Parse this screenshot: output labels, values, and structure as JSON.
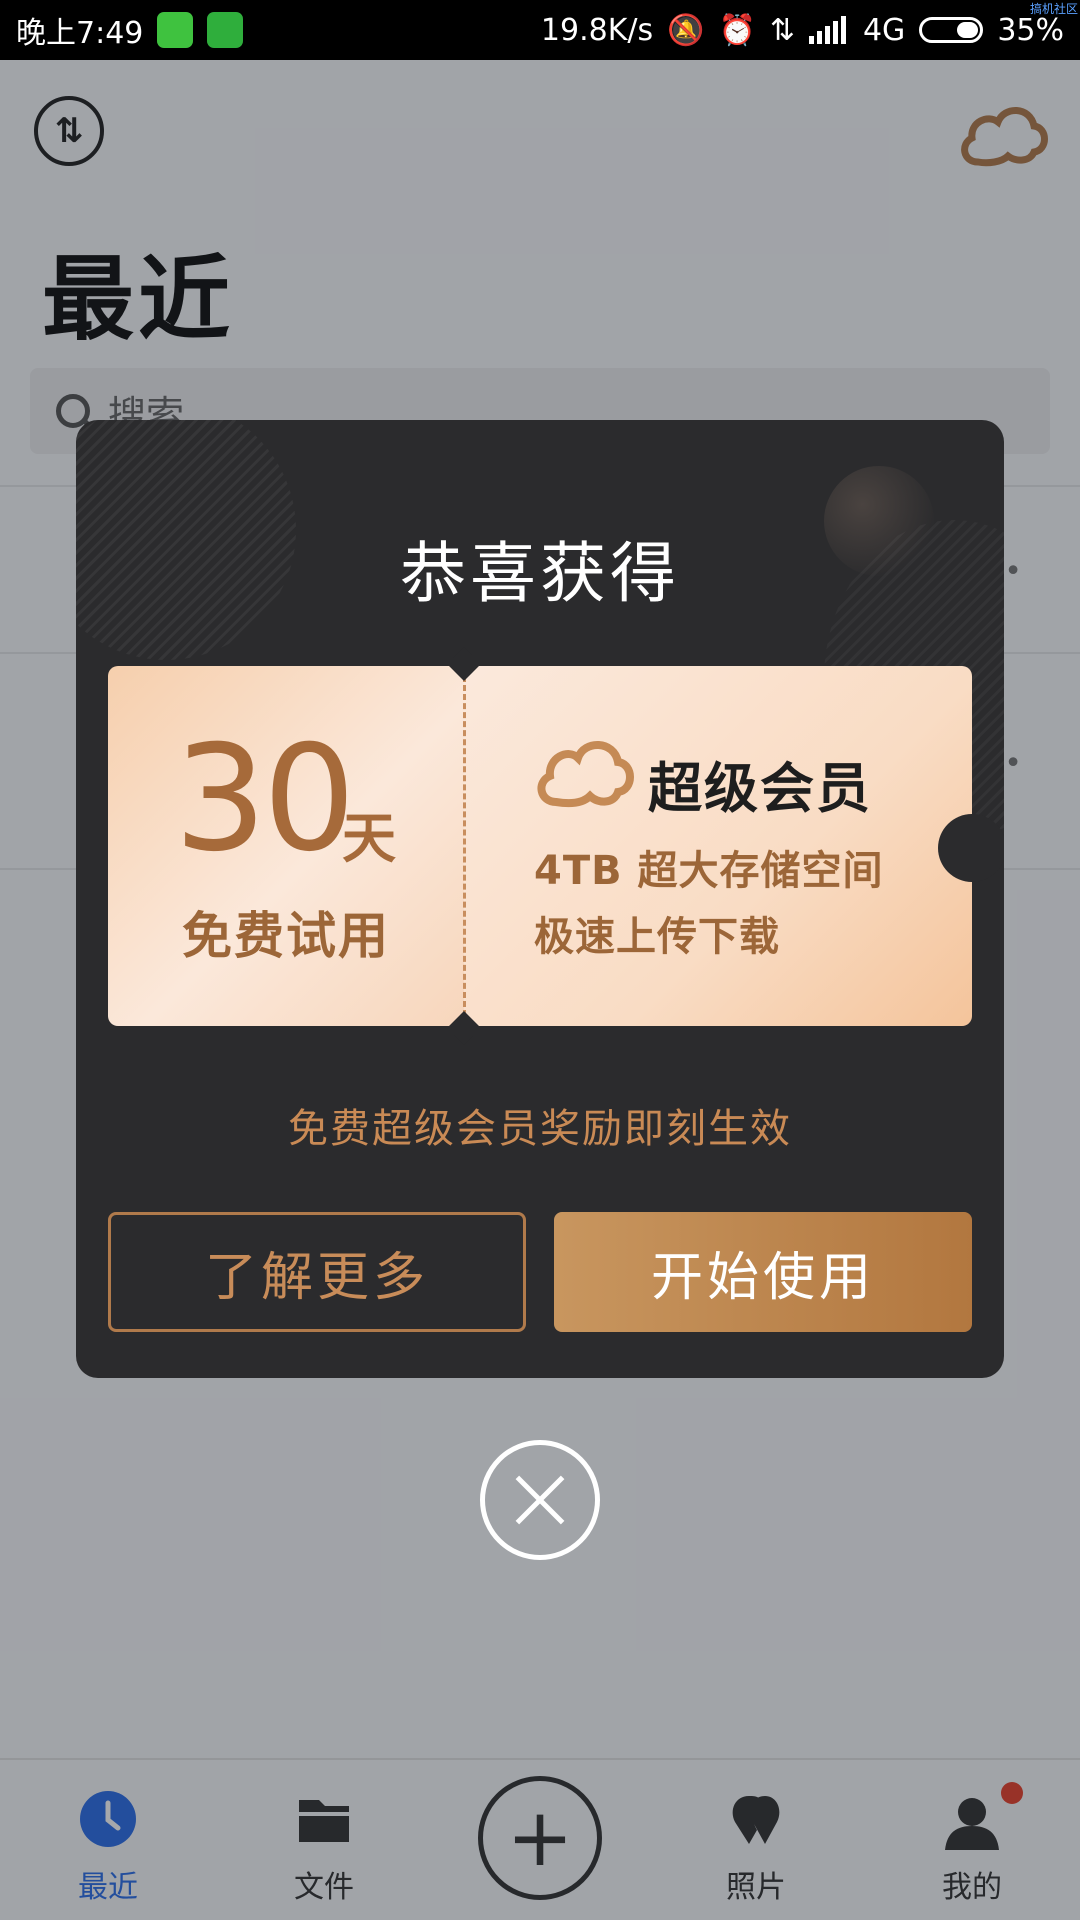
{
  "status_bar": {
    "time": "晚上7:49",
    "network_speed": "19.8K/s",
    "network_type": "4G",
    "battery_percent": "35%",
    "watermark": "搞机社区",
    "icons": [
      "notification-app-icon",
      "messaging-app-icon",
      "mute-bell-icon",
      "alarm-icon",
      "data-transfer-icon",
      "signal-icon",
      "battery-icon"
    ]
  },
  "app": {
    "page_title": "最近",
    "search": {
      "placeholder": "搜索"
    },
    "list_more_glyph": "•••"
  },
  "bottom_nav": {
    "items": [
      {
        "label": "最近",
        "icon": "clock-icon",
        "active": true
      },
      {
        "label": "文件",
        "icon": "folder-icon",
        "active": false
      },
      {
        "label": "照片",
        "icon": "photos-icon",
        "active": false
      },
      {
        "label": "我的",
        "icon": "user-icon",
        "active": false,
        "badge": true
      }
    ],
    "add_glyph": "+"
  },
  "dialog": {
    "title": "恭喜获得",
    "ticket": {
      "days": "30",
      "days_unit": "天",
      "trial_label": "免费试用",
      "vip_title": "超级会员",
      "benefit_1": "4TB 超大存储空间",
      "benefit_2": "极速上传下载"
    },
    "note": "免费超级会员奖励即刻生效",
    "learn_more": "了解更多",
    "start": "开始使用"
  },
  "colors": {
    "accent_gold": "#b2773f",
    "active_blue": "#2c6fe8",
    "dialog_bg": "#2b2b2d"
  }
}
